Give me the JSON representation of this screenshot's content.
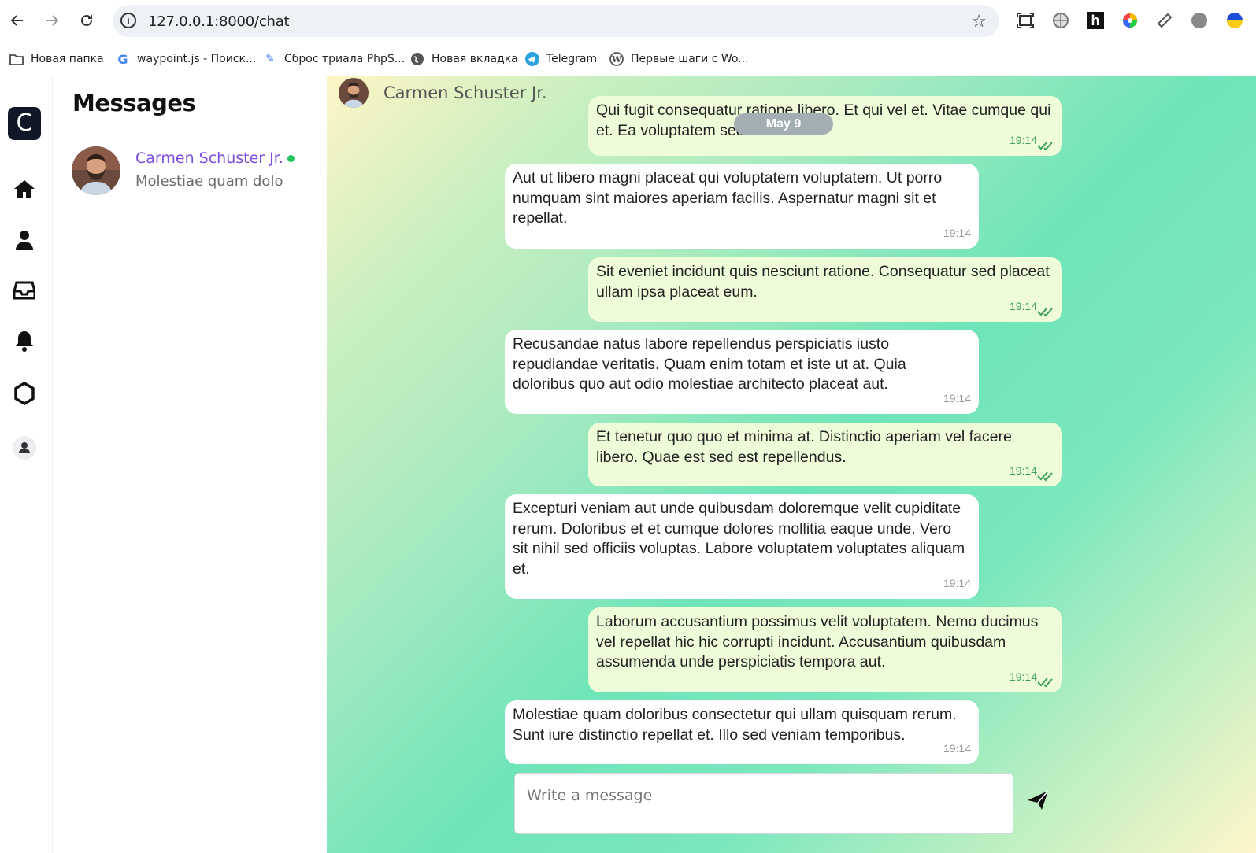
{
  "browser": {
    "url": "127.0.0.1:8000/chat",
    "bookmarks": [
      {
        "label": "Новая папка",
        "icon": "folder-icon"
      },
      {
        "label": "waypoint.js - Поиск...",
        "icon": "google-icon"
      },
      {
        "label": "Сброс триала PhpS...",
        "icon": "pen-icon"
      },
      {
        "label": "Новая вкладка",
        "icon": "globe-icon"
      },
      {
        "label": "Telegram",
        "icon": "telegram-icon"
      },
      {
        "label": "Первые шаги с Wo...",
        "icon": "wordpress-icon"
      }
    ]
  },
  "sidebar": {
    "logo_letter": "C",
    "icons": [
      "home-icon",
      "user-icon",
      "inbox-icon",
      "bell-icon",
      "settings-icon",
      "avatar-icon"
    ]
  },
  "conversations": {
    "title": "Messages",
    "items": [
      {
        "name": "Carmen Schuster Jr.",
        "preview": "Molestiae quam dolo",
        "online": true
      }
    ]
  },
  "chat": {
    "contact_name": "Carmen Schuster Jr.",
    "date_label": "May 9",
    "messages": [
      {
        "direction": "out",
        "text": "Qui fugit consequatur ratione libero. Et qui vel et. Vitae cumque qui et. Ea voluptatem sed.",
        "time": "19:14"
      },
      {
        "direction": "in",
        "text": "Aut ut libero magni placeat qui voluptatem voluptatem. Ut porro numquam sint maiores aperiam facilis. Aspernatur magni sit et repellat.",
        "time": "19:14"
      },
      {
        "direction": "out",
        "text": "Sit eveniet incidunt quis nesciunt ratione. Consequatur sed placeat ullam ipsa placeat eum.",
        "time": "19:14"
      },
      {
        "direction": "in",
        "text": "Recusandae natus labore repellendus perspiciatis iusto repudiandae veritatis. Quam enim totam et iste ut at. Quia doloribus quo aut odio molestiae architecto placeat aut.",
        "time": "19:14"
      },
      {
        "direction": "out",
        "text": "Et tenetur quo quo et minima at. Distinctio aperiam vel facere libero. Quae est sed est repellendus.",
        "time": "19:14"
      },
      {
        "direction": "in",
        "text": "Excepturi veniam aut unde quibusdam doloremque velit cupiditate rerum. Doloribus et et cumque dolores mollitia eaque unde. Vero sit nihil sed officiis voluptas. Labore voluptatem voluptates aliquam et.",
        "time": "19:14"
      },
      {
        "direction": "out",
        "text": "Laborum accusantium possimus velit voluptatem. Nemo ducimus vel repellat hic hic corrupti incidunt. Accusantium quibusdam assumenda unde perspiciatis tempora aut.",
        "time": "19:14"
      },
      {
        "direction": "in",
        "text": "Molestiae quam doloribus consectetur qui ullam quisquam rerum. Sunt iure distinctio repellat et. Illo sed veniam temporibus.",
        "time": "19:14"
      }
    ],
    "composer_placeholder": "Write a message"
  },
  "colors": {
    "accent": "#7c4ddd",
    "online": "#22c55e",
    "outgoing_bubble": "#eefcd9",
    "read_ticks": "#3ea05a"
  }
}
